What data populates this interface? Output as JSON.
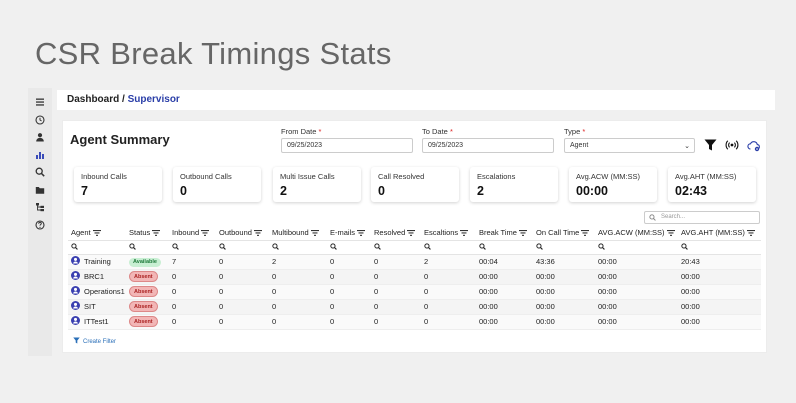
{
  "page_title": "CSR Break Timings Stats",
  "breadcrumb": {
    "root": "Dashboard",
    "separator": "/",
    "current": "Supervisor"
  },
  "summary_title": "Agent Summary",
  "filters": {
    "from_date": {
      "label": "From Date",
      "value": "09/25/2023"
    },
    "to_date": {
      "label": "To Date",
      "value": "09/25/2023"
    },
    "type": {
      "label": "Type",
      "value": "Agent"
    },
    "required_mark": "*"
  },
  "stats": [
    {
      "label": "Inbound Calls",
      "value": "7"
    },
    {
      "label": "Outbound Calls",
      "value": "0"
    },
    {
      "label": "Multi Issue Calls",
      "value": "2"
    },
    {
      "label": "Call Resolved",
      "value": "0"
    },
    {
      "label": "Escalations",
      "value": "2"
    },
    {
      "label": "Avg.ACW (MM:SS)",
      "value": "00:00"
    },
    {
      "label": "Avg.AHT (MM:SS)",
      "value": "02:43"
    }
  ],
  "search_placeholder": "Search...",
  "columns": [
    "Agent",
    "Status",
    "Inbound",
    "Outbound",
    "Multibound",
    "E-mails",
    "Resolved",
    "Escaltions",
    "Break Time",
    "On Call Time",
    "AVG.ACW (MM:SS)",
    "AVG.AHT (MM:SS)"
  ],
  "rows": [
    {
      "agent": "Training",
      "status": "Available",
      "status_type": "available",
      "inbound": "7",
      "outbound": "0",
      "multibound": "2",
      "emails": "0",
      "resolved": "0",
      "escalations": "2",
      "break_time": "00:04",
      "on_call_time": "43:36",
      "avg_acw": "00:00",
      "avg_aht": "20:43"
    },
    {
      "agent": "BRC1",
      "status": "Absent",
      "status_type": "absent",
      "inbound": "0",
      "outbound": "0",
      "multibound": "0",
      "emails": "0",
      "resolved": "0",
      "escalations": "0",
      "break_time": "00:00",
      "on_call_time": "00:00",
      "avg_acw": "00:00",
      "avg_aht": "00:00"
    },
    {
      "agent": "Operations1",
      "status": "Absent",
      "status_type": "absent",
      "inbound": "0",
      "outbound": "0",
      "multibound": "0",
      "emails": "0",
      "resolved": "0",
      "escalations": "0",
      "break_time": "00:00",
      "on_call_time": "00:00",
      "avg_acw": "00:00",
      "avg_aht": "00:00"
    },
    {
      "agent": "SIT",
      "status": "Absent",
      "status_type": "absent",
      "inbound": "0",
      "outbound": "0",
      "multibound": "0",
      "emails": "0",
      "resolved": "0",
      "escalations": "0",
      "break_time": "00:00",
      "on_call_time": "00:00",
      "avg_acw": "00:00",
      "avg_aht": "00:00"
    },
    {
      "agent": "ITTest1",
      "status": "Absent",
      "status_type": "absent",
      "inbound": "0",
      "outbound": "0",
      "multibound": "0",
      "emails": "0",
      "resolved": "0",
      "escalations": "0",
      "break_time": "00:00",
      "on_call_time": "00:00",
      "avg_acw": "00:00",
      "avg_aht": "00:00"
    }
  ],
  "create_filter_label": "Create Filter",
  "colors": {
    "accent": "#2a3ea8",
    "available_bg": "#c8efd3",
    "absent_bg": "#f2b6b6"
  }
}
